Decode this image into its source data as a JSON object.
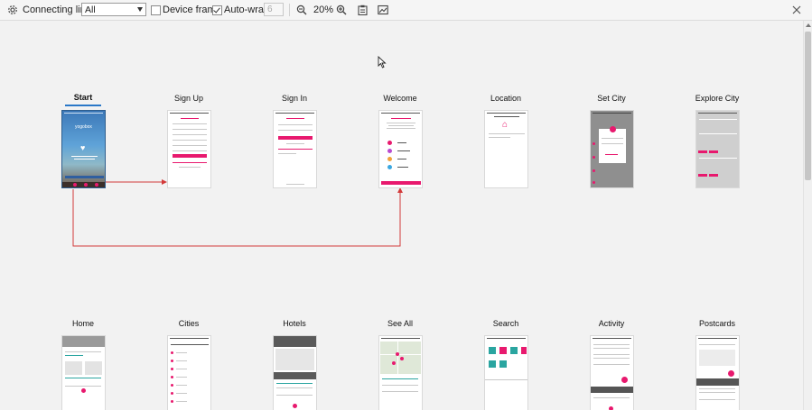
{
  "toolbar": {
    "connecting_lines_label": "Connecting lines",
    "connecting_lines_value": "All",
    "device_frame_label": "Device frame",
    "device_frame_checked": false,
    "auto_wrap_label": "Auto-wrap",
    "auto_wrap_checked": true,
    "wrap_count_placeholder": "6",
    "zoom_level": "20%",
    "icons": [
      "gear-icon",
      "chevron-down-icon",
      "zoom-out-icon",
      "zoom-in-icon",
      "clipboard-icon",
      "image-export-icon",
      "close-icon"
    ]
  },
  "screens_row1": [
    {
      "label": "Start",
      "selected": true
    },
    {
      "label": "Sign Up"
    },
    {
      "label": "Sign In"
    },
    {
      "label": "Welcome"
    },
    {
      "label": "Location"
    },
    {
      "label": "Set City"
    },
    {
      "label": "Explore City"
    }
  ],
  "screens_row2": [
    {
      "label": "Home"
    },
    {
      "label": "Cities"
    },
    {
      "label": "Hotels"
    },
    {
      "label": "See All"
    },
    {
      "label": "Search"
    },
    {
      "label": "Activity"
    },
    {
      "label": "Postcards"
    }
  ],
  "start_screen": {
    "brand_text": "yogobox"
  },
  "colors": {
    "accent": "#e8196e",
    "connector": "#d33a3a",
    "selection": "#2a78c8"
  }
}
